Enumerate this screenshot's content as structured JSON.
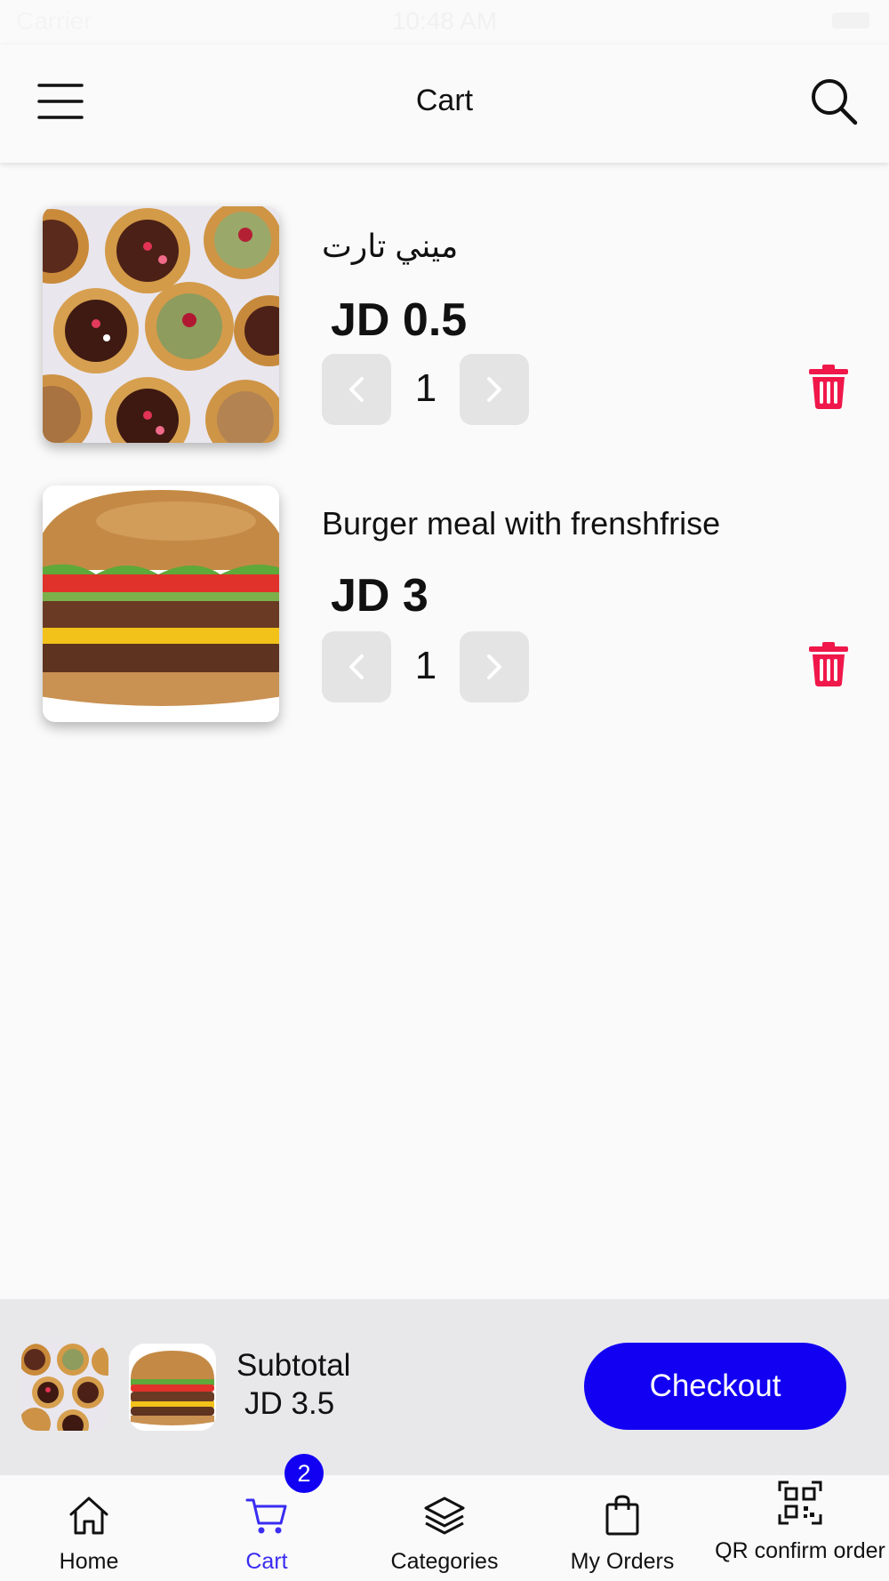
{
  "status": {
    "carrier": "Carrier",
    "time": "10:48 AM"
  },
  "header": {
    "title": "Cart"
  },
  "cart_items": [
    {
      "name": "ميني تارت",
      "price": "JD 0.5",
      "quantity": "1"
    },
    {
      "name": "Burger meal with frenshfrise",
      "price": "JD 3",
      "quantity": "1"
    }
  ],
  "summary": {
    "subtotal_label": "Subtotal",
    "subtotal_value": "JD 3.5",
    "checkout_label": "Checkout"
  },
  "tabbar": {
    "items": [
      {
        "label": "Home",
        "icon": "home-icon"
      },
      {
        "label": "Cart",
        "icon": "cart-icon",
        "badge": "2",
        "active": true
      },
      {
        "label": "Categories",
        "icon": "layers-icon"
      },
      {
        "label": "My Orders",
        "icon": "shopping-bag-icon"
      },
      {
        "label": "QR confirm order",
        "icon": "qr-code-icon"
      }
    ]
  },
  "colors": {
    "accent": "#1200f2",
    "delete": "#f0174a",
    "active_tab": "#3a2cf2"
  }
}
